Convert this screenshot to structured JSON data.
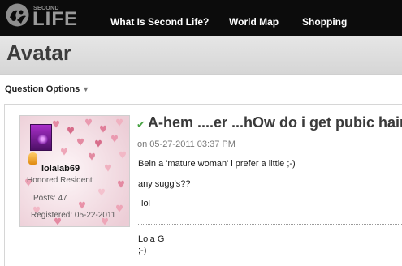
{
  "site": {
    "logo_small": "SECOND",
    "logo_big": "LIFE"
  },
  "nav": {
    "items": [
      {
        "label": "What Is Second Life?"
      },
      {
        "label": "World Map"
      },
      {
        "label": "Shopping"
      }
    ]
  },
  "page": {
    "title": "Avatar"
  },
  "question_options": {
    "label": "Question Options"
  },
  "author": {
    "username": "lolalab69",
    "rank": "Honored Resident",
    "posts": "Posts: 47",
    "registered": "Registered: 05-22-2011"
  },
  "post": {
    "title": "A-hem ....er ...hOw do i get pubic hair?",
    "date": "on 05-27-2011 03:37 PM",
    "lines": [
      "Bein a 'mature woman' i prefer a little ;-)",
      "any sugg's??",
      "lol"
    ],
    "signature": [
      "Lola G",
      ";-)"
    ]
  },
  "colors": {
    "topbar": "#0c0c0c",
    "accent_check": "#49a344",
    "title_text": "#3c3c3c"
  },
  "icons": {
    "logo": "second-life-eye-icon",
    "dropdown": "caret-down-icon",
    "solved": "checkmark-icon",
    "rank": "rank-badge-icon"
  }
}
